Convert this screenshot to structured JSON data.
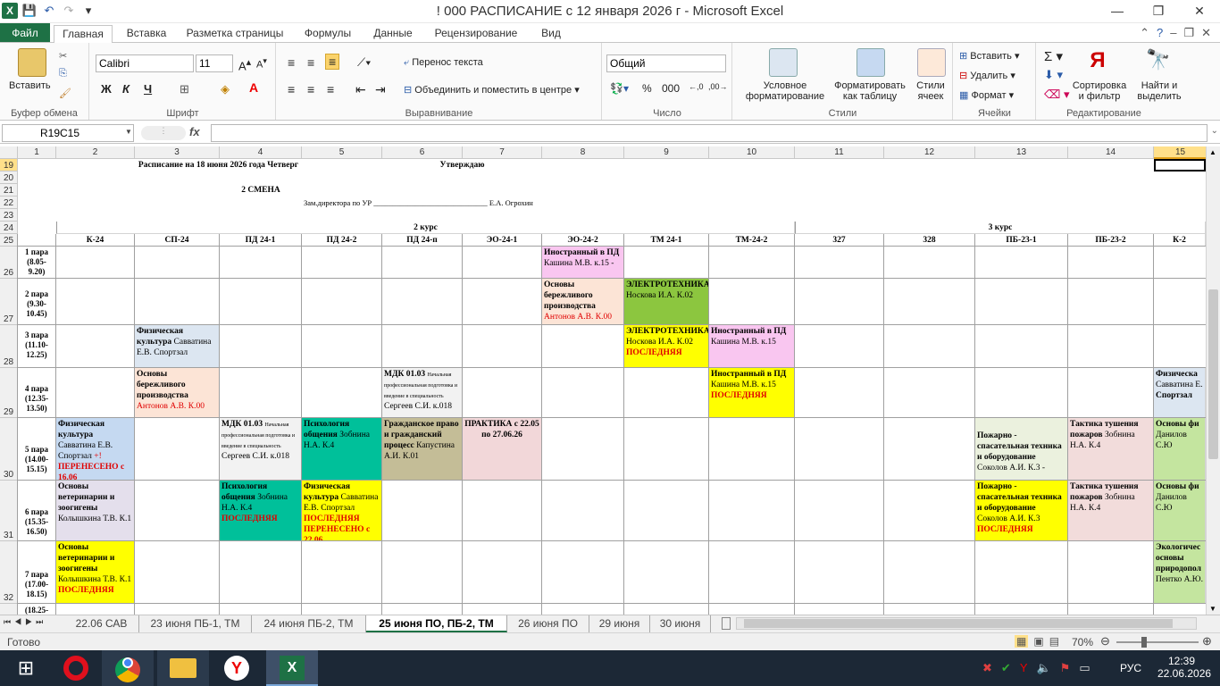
{
  "window": {
    "title": "! 000 РАСПИСАНИЕ с 12 января 2026 г  -  Microsoft Excel"
  },
  "ribbon_tabs": [
    "Файл",
    "Главная",
    "Вставка",
    "Разметка страницы",
    "Формулы",
    "Данные",
    "Рецензирование",
    "Вид"
  ],
  "ribbon": {
    "paste": "Вставить",
    "clipboard": "Буфер обмена",
    "font_name": "Calibri",
    "font_size": "11",
    "bold": "Ж",
    "italic": "К",
    "underline": "Ч",
    "font_group": "Шрифт",
    "wrap_text": "Перенос текста",
    "merge_center": "Объединить и поместить в центре",
    "alignment_group": "Выравнивание",
    "number_format": "Общий",
    "number_group": "Число",
    "cond_format": "Условное форматирование",
    "format_table": "Форматировать как таблицу",
    "cell_styles": "Стили ячеек",
    "styles_group": "Стили",
    "insert": "Вставить",
    "delete": "Удалить",
    "format": "Формат",
    "cells_group": "Ячейки",
    "sort_filter": "Сортировка и фильтр",
    "find_select": "Найти и выделить",
    "editing_group": "Редактирование"
  },
  "formula": {
    "namebox": "R19C15",
    "fx": "fx",
    "value": ""
  },
  "columns": [
    "1",
    "2",
    "3",
    "4",
    "5",
    "6",
    "7",
    "8",
    "9",
    "10",
    "11",
    "12",
    "13",
    "14",
    "15"
  ],
  "rows": [
    "19",
    "20",
    "21",
    "22",
    "23",
    "24",
    "25",
    "26",
    "27",
    "28",
    "29",
    "30",
    "31",
    "32"
  ],
  "header": {
    "title": "Расписание на 18 июня 2026 года  Четверг",
    "approve": "Утверждаю",
    "shift": "2 СМЕНА",
    "deputy": "Зам.директора по УР ______________________________ Е.А. Огрохин",
    "course2": "2 курс",
    "course3": "3 курс"
  },
  "groups": [
    "К-24",
    "СП-24",
    "ПД 24-1",
    "ПД 24-2",
    "ПД 24-п",
    "ЭО-24-1",
    "ЭО-24-2",
    "ТМ 24-1",
    "ТМ-24-2",
    "327",
    "328",
    "ПБ-23-1",
    "ПБ-23-2",
    "К-2"
  ],
  "pairs": [
    {
      "l1": "1 пара",
      "l2": "(8.05-",
      "l3": "9.20)"
    },
    {
      "l1": "2 пара",
      "l2": "(9.30-",
      "l3": "10.45)"
    },
    {
      "l1": "3 пара",
      "l2": "(11.10-",
      "l3": "12.25)"
    },
    {
      "l1": "4 пара",
      "l2": "(12.35-",
      "l3": "13.50)"
    },
    {
      "l1": "5 пара",
      "l2": "(14.00-",
      "l3": "15.15)"
    },
    {
      "l1": "6 пара",
      "l2": "(15.35-",
      "l3": "16.50)"
    },
    {
      "l1": "7 пара",
      "l2": "(17.00-",
      "l3": "18.15)"
    }
  ],
  "pair8": "(18.25-",
  "cells": {
    "r1_eo2": {
      "a": "Иностранный в ПД",
      "b": "Кашина М.В. к.15  -"
    },
    "r2_eo2": {
      "a": "Основы бережливого производства",
      "b": "Антонов А.В. К.00"
    },
    "r2_tm1": {
      "a": "ЭЛЕКТРОТЕХНИКА",
      "b": "Носкова И.А. К.02"
    },
    "r3_sp": {
      "a": "Физическая культура",
      "b": "Савватина Е.В. Спортзал"
    },
    "r3_tm1": {
      "a": "ЭЛЕКТРОТЕХНИКА",
      "b": "Носкова И.А. К.02",
      "c": "ПОСЛЕДНЯЯ"
    },
    "r3_tm2": {
      "a": "Иностранный в ПД",
      "b": "Кашина М.В. к.15"
    },
    "r4_sp": {
      "a": "Основы бережливого производства",
      "b": "Антонов А.В. К.00"
    },
    "r4_pdp": {
      "a": "МДК 01.03",
      "s": "Начальная профессиональная подготовка и введение в специальность",
      "b": "Сергеев С.И. к.018"
    },
    "r4_tm2": {
      "a": "Иностранный в ПД",
      "b": "Кашина М.В. к.15",
      "c": "ПОСЛЕДНЯЯ"
    },
    "r4_k2": {
      "a": "Физическа",
      "b": "Савватина Е.",
      "c": "Спортзал"
    },
    "r5_k": {
      "a": "Физическая культура",
      "b": "Савватина Е.В. Спортзал",
      "p": "+!",
      "c": "ПЕРЕНЕСЕНО с 16.06"
    },
    "r5_pd1": {
      "a": "МДК 01.03",
      "s": "Начальная профессиональная подготовка и введение в специальность",
      "b": "Сергеев С.И. к.018"
    },
    "r5_pd2": {
      "a": "Психология общения",
      "b": "Зобнина Н.А. К.4"
    },
    "r5_pdp": {
      "a": "Гражданское право и гражданский процесс",
      "b": "Капустина А.И. К.01"
    },
    "r5_eo1": {
      "a": "ПРАКТИКА  с 22.05 по 27.06.26"
    },
    "r5_pb1": {
      "a": "Пожарно - спасательная техника и оборудование",
      "b": "Соколов А.И. К.3 -"
    },
    "r5_pb2": {
      "a": "Тактика тушения пожаров",
      "b": "Зобнина Н.А. К.4"
    },
    "r5_k2": {
      "a": "Основы фи",
      "b": "Данилов С.Ю"
    },
    "r6_k": {
      "a": "Основы ветеринарии и зоогигены",
      "b": "Колышкина Т.В. К.1"
    },
    "r6_pd1": {
      "a": "Психология общения",
      "b": "Зобнина Н.А. К.4",
      "c": "ПОСЛЕДНЯЯ"
    },
    "r6_pd2": {
      "a": "Физическая культура",
      "b": "Савватина Е.В. Спортзал",
      "c": "ПОСЛЕДНЯЯ",
      "d": "ПЕРЕНЕСЕНО с 22.06"
    },
    "r6_pb1": {
      "a": "Пожарно - спасательная техника и оборудование",
      "b": "Соколов А.И. К.3",
      "c": "ПОСЛЕДНЯЯ"
    },
    "r6_pb2": {
      "a": "Тактика тушения пожаров",
      "b": "Зобнина Н.А. К.4"
    },
    "r6_k2": {
      "a": "Основы фи",
      "b": "Данилов С.Ю"
    },
    "r7_k": {
      "a": "Основы ветеринарии и зоогигены",
      "b": "Колышкина Т.В. К.1",
      "c": "ПОСЛЕДНЯЯ"
    },
    "r7_k2": {
      "a": "Экологичес основы природопол",
      "b": "Пентко А.Ю."
    }
  },
  "sheet_tabs": [
    "22.06 САВ",
    "23 июня ПБ-1, ТМ",
    "24 июня ПБ-2, ТМ",
    "25 июня ПО, ПБ-2, ТМ",
    "26 июня ПО",
    "29 июня",
    "30 июня"
  ],
  "status": {
    "ready": "Готово",
    "zoom": "70%"
  },
  "taskbar": {
    "lang": "РУС",
    "time": "12:39",
    "date": "22.06.2026"
  },
  "colors": {
    "excel_green": "#1e7145",
    "pink": "#f9c6f0",
    "peach": "#fce4d6",
    "green": "#8cc63f",
    "lightblue": "#dce6f1",
    "teal": "#00c09a",
    "tan": "#c4bd97",
    "rose": "#f2d7d9",
    "yellow": "#ffff00",
    "lavender": "#e4dfec",
    "lightgreen": "#c4e59f",
    "salmon": "#f2dcdb"
  }
}
